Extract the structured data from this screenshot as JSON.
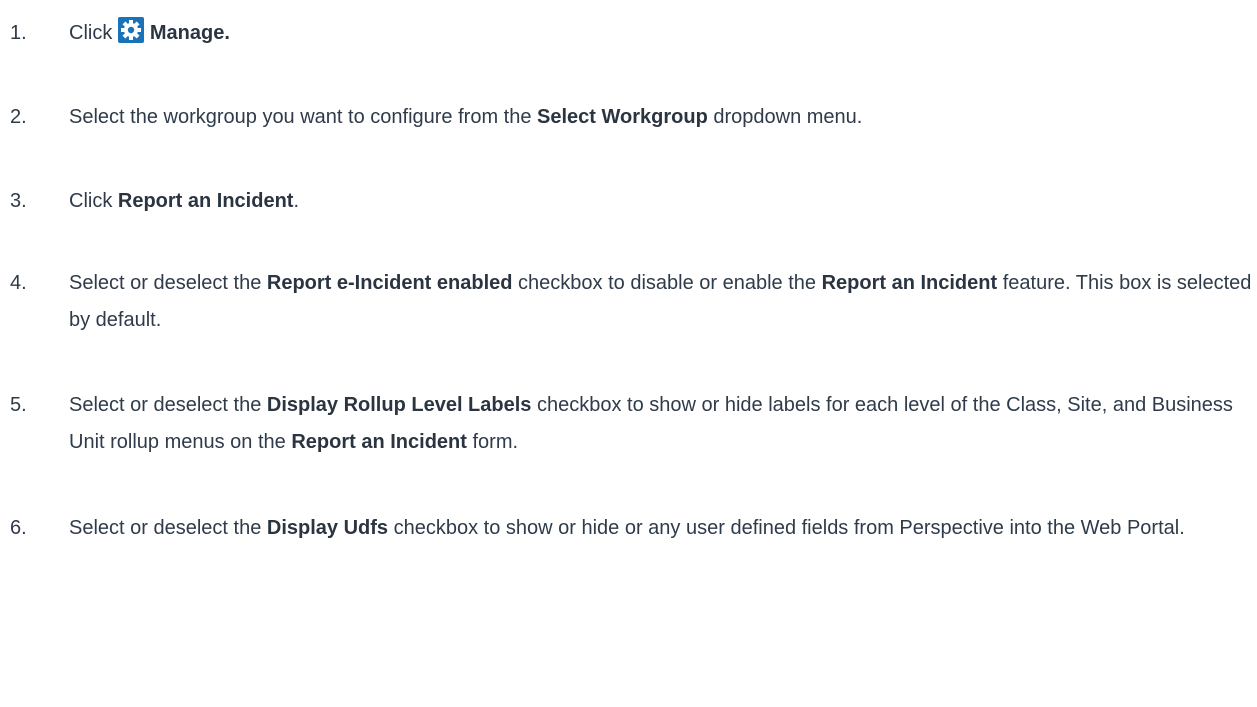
{
  "steps": [
    {
      "num": "1.",
      "parts": [
        {
          "t": "Click "
        },
        {
          "icon": "gear-icon"
        },
        {
          "t": "Manage.",
          "b": true
        }
      ]
    },
    {
      "num": "2.",
      "parts": [
        {
          "t": "Select the workgroup you want to configure from the "
        },
        {
          "t": "Select Workgroup",
          "b": true
        },
        {
          "t": " dropdown menu."
        }
      ]
    },
    {
      "num": "3.",
      "parts": [
        {
          "t": "Click "
        },
        {
          "t": "Report an Incident",
          "b": true
        },
        {
          "t": "."
        }
      ]
    },
    {
      "num": "4.",
      "parts": [
        {
          "t": "Select or deselect the "
        },
        {
          "t": "Report e-Incident enabled",
          "b": true
        },
        {
          "t": " checkbox to disable or enable the "
        },
        {
          "t": "Report an Incident",
          "b": true
        },
        {
          "t": " feature. This box is selected by default."
        }
      ]
    },
    {
      "num": "5.",
      "parts": [
        {
          "t": "Select or deselect the "
        },
        {
          "t": "Display Rollup Level Labels",
          "b": true
        },
        {
          "t": " checkbox to show or hide labels for each level of the Class, Site, and Business Unit rollup menus on the "
        },
        {
          "t": "Report an Incident",
          "b": true
        },
        {
          "t": " form."
        }
      ]
    },
    {
      "num": "6.",
      "parts": [
        {
          "t": "Select or deselect the "
        },
        {
          "t": "Display Udfs",
          "b": true
        },
        {
          "t": " checkbox to show or hide or any user defined fields from Perspective into the Web Portal."
        }
      ]
    }
  ],
  "colors": {
    "text": "#2f3b4a",
    "gear_bg": "#1a73b8"
  }
}
